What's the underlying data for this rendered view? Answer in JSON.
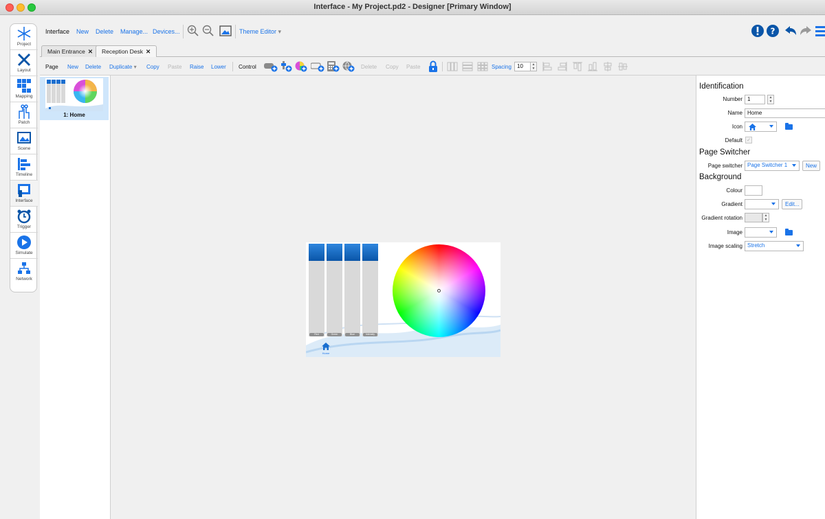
{
  "window": {
    "title": "Interface - My Project.pd2 - Designer [Primary Window]"
  },
  "modes": [
    {
      "label": "Project"
    },
    {
      "label": "Layout"
    },
    {
      "label": "Mapping"
    },
    {
      "label": "Patch"
    },
    {
      "label": "Scene"
    },
    {
      "label": "Timeline"
    },
    {
      "label": "Interface"
    },
    {
      "label": "Trigger"
    },
    {
      "label": "Simulate"
    },
    {
      "label": "Network"
    }
  ],
  "toolbar": {
    "section": "Interface",
    "new": "New",
    "delete": "Delete",
    "manage": "Manage...",
    "devices": "Devices...",
    "theme_editor": "Theme Editor"
  },
  "tabs": [
    {
      "label": "Main Entrance",
      "close": "✕"
    },
    {
      "label": "Reception Desk",
      "close": "✕"
    }
  ],
  "page_toolbar": {
    "page": "Page",
    "new": "New",
    "delete": "Delete",
    "duplicate": "Duplicate",
    "copy": "Copy",
    "paste": "Paste",
    "raise": "Raise",
    "lower": "Lower",
    "control": "Control",
    "c_delete": "Delete",
    "c_copy": "Copy",
    "c_paste": "Paste",
    "spacing_label": "Spacing",
    "spacing_value": "10"
  },
  "pages": [
    {
      "label": "1: Home"
    }
  ],
  "preview": {
    "faders": [
      {
        "label": "Red"
      },
      {
        "label": "Green"
      },
      {
        "label": "Blue"
      },
      {
        "label": "Intensity"
      }
    ],
    "home_label": "Home"
  },
  "inspector": {
    "identification": "Identification",
    "number_label": "Number",
    "number_value": "1",
    "name_label": "Name",
    "name_value": "Home",
    "icon_label": "Icon",
    "default_label": "Default",
    "page_switcher_title": "Page Switcher",
    "page_switcher_label": "Page switcher",
    "page_switcher_value": "Page Switcher 1",
    "new_button": "New",
    "background_title": "Background",
    "colour_label": "Colour",
    "gradient_label": "Gradient",
    "edit_button": "Edit...",
    "gradient_rotation_label": "Gradient rotation",
    "image_label": "Image",
    "image_scaling_label": "Image scaling",
    "image_scaling_value": "Stretch"
  }
}
